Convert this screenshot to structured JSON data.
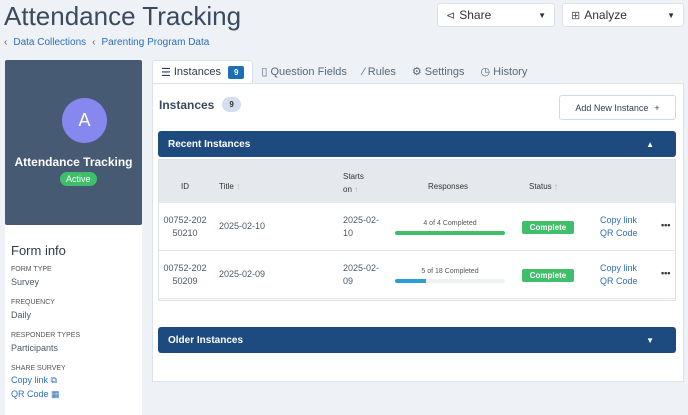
{
  "header": {
    "title": "Attendance Tracking",
    "share": "Share",
    "analyze": "Analyze"
  },
  "breadcrumb": [
    "Data Collections",
    "Parenting Program Data"
  ],
  "sidebar": {
    "avatar_letter": "A",
    "name": "Attendance Tracking",
    "status": "Active",
    "form_info_title": "Form info",
    "fields": [
      {
        "label": "FORM TYPE",
        "value": "Survey"
      },
      {
        "label": "FREQUENCY",
        "value": "Daily"
      },
      {
        "label": "RESPONDER TYPES",
        "value": "Participants"
      }
    ],
    "share_label": "SHARE SURVEY",
    "copy_link": "Copy link",
    "qr_code": "QR Code"
  },
  "tabs": [
    {
      "label": "Instances",
      "badge": "9"
    },
    {
      "label": "Question Fields"
    },
    {
      "label": "Rules"
    },
    {
      "label": "Settings"
    },
    {
      "label": "History"
    }
  ],
  "main": {
    "heading": "Instances",
    "count": "9",
    "add_button": "Add New Instance",
    "recent": "Recent Instances",
    "older": "Older Instances",
    "columns": [
      "ID",
      "Title",
      "Starts on",
      "Responses",
      "Status"
    ],
    "rows": [
      {
        "id": "00752-20250210",
        "title": "2025-02-10",
        "starts": "2025-02-10",
        "responses": "4 of 4 Completed",
        "progress": 1.0,
        "color": "#3fbf6a",
        "status": "Complete",
        "copy": "Copy link",
        "qr": "QR Code",
        "more": "•••"
      },
      {
        "id": "00752-20250209",
        "title": "2025-02-09",
        "starts": "2025-02-09",
        "responses": "5 of 18 Completed",
        "progress": 0.28,
        "color": "#2a9fd6",
        "status": "Complete",
        "copy": "Copy link",
        "qr": "QR Code",
        "more": "•••"
      }
    ]
  }
}
